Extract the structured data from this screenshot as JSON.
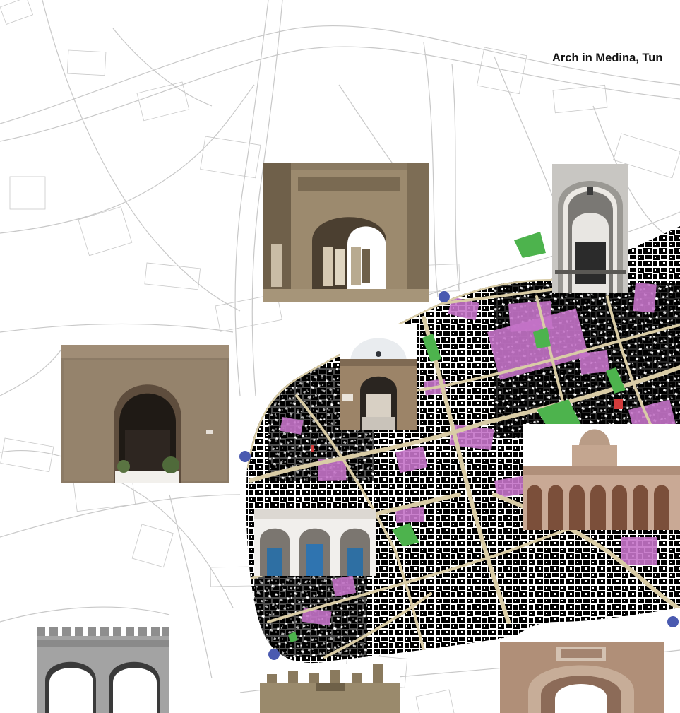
{
  "title": "Arch in Medina, Tun",
  "legend_colors": {
    "buildings": "#000000",
    "commercial": "#c473c8",
    "green_space": "#4db34d",
    "streets": "#d9cca6",
    "gate_marker": "#4a5ab0",
    "landmark": "#d23b3b",
    "outer_streets": "#c8c8c8"
  },
  "photos": [
    {
      "name": "arched-gate-historic-photo",
      "tone": "sepia"
    },
    {
      "name": "stone-arch-gate-photo",
      "tone": "stone"
    },
    {
      "name": "mosque-doorway-photo",
      "tone": "stone"
    },
    {
      "name": "ornate-arched-door-photo",
      "tone": "marble"
    },
    {
      "name": "colonnade-arches-photo",
      "tone": "tan"
    },
    {
      "name": "arcade-blue-doors-photo",
      "tone": "white"
    },
    {
      "name": "crenellated-gate-photo",
      "tone": "grey"
    },
    {
      "name": "crenellated-wall-photo",
      "tone": "stone"
    },
    {
      "name": "carved-arch-gate-photo",
      "tone": "sand"
    }
  ]
}
